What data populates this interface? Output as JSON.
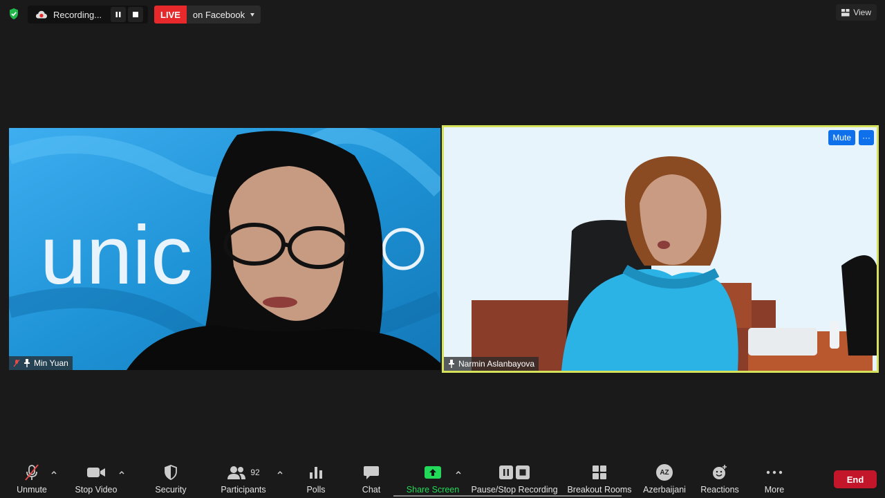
{
  "recording": {
    "label": "Recording..."
  },
  "live": {
    "tag": "LIVE",
    "destination": "on Facebook"
  },
  "view": {
    "label": "View"
  },
  "participants_tiles": [
    {
      "name": "Min Yuan"
    },
    {
      "name": "Narmin Aslanbayova"
    }
  ],
  "tile_buttons": {
    "mute": "Mute",
    "more": "···"
  },
  "background_text": "unic",
  "toolbar": {
    "unmute": "Unmute",
    "stop_video": "Stop Video",
    "security": "Security",
    "participants": "Participants",
    "participants_count": "92",
    "polls": "Polls",
    "chat": "Chat",
    "share_screen": "Share Screen",
    "pause_stop_recording": "Pause/Stop Recording",
    "breakout_rooms": "Breakout Rooms",
    "language": "Azerbaijani",
    "language_code": "AZ",
    "reactions": "Reactions",
    "more": "More",
    "end": "End"
  },
  "colors": {
    "live": "#e8292b",
    "share_green": "#23d959",
    "end_red": "#c3162a",
    "active_speaker_border": "#d6e35a",
    "mute_blue": "#0e71eb"
  }
}
